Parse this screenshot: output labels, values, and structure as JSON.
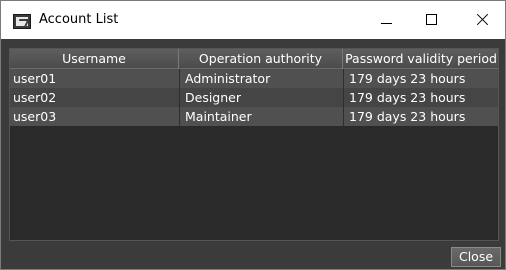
{
  "window": {
    "title": "Account List",
    "icon": "app-window-icon",
    "controls": [
      "minimize-icon",
      "maximize-icon",
      "close-icon"
    ]
  },
  "table": {
    "columns": [
      "Username",
      "Operation authority",
      "Password validity period"
    ],
    "rows": [
      [
        "user01",
        "Administrator",
        "179 days 23 hours"
      ],
      [
        "user02",
        "Designer",
        "179 days 23 hours"
      ],
      [
        "user03",
        "Maintainer",
        "179 days 23 hours"
      ]
    ]
  },
  "footer": {
    "close_label": "Close"
  },
  "colors": {
    "panel_bg": "#3b3b3b",
    "table_bg": "#2a2a2a",
    "header_bg": "#555555",
    "row_odd": "#505050",
    "row_even": "#454545",
    "text": "#ffffff"
  }
}
